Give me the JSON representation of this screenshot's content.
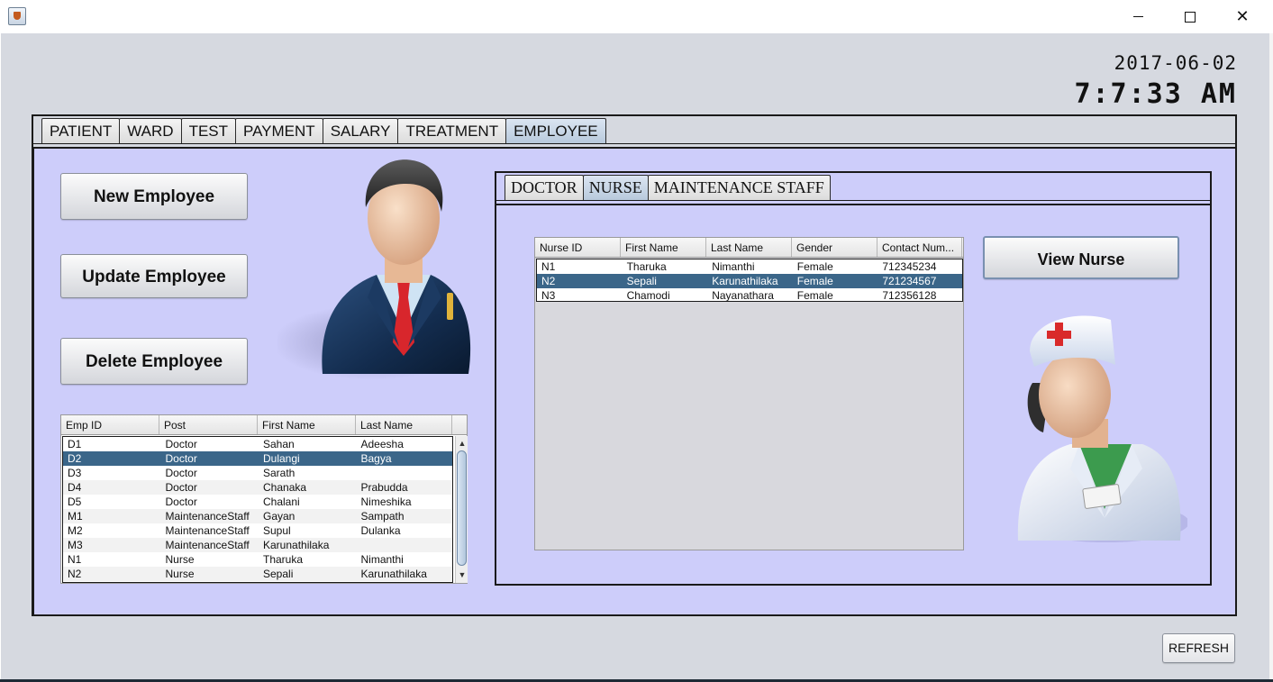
{
  "window": {
    "close_glyph": "✕"
  },
  "clock": {
    "date": "2017-06-02",
    "time": "7:7:33 AM"
  },
  "main_tabs": [
    "PATIENT",
    "WARD",
    "TEST",
    "PAYMENT",
    "SALARY",
    "TREATMENT",
    "EMPLOYEE"
  ],
  "main_tabs_active": "EMPLOYEE",
  "employee": {
    "new_button": "New Employee",
    "update_button": "Update Employee",
    "delete_button": "Delete Employee",
    "table": {
      "columns": [
        "Emp ID",
        "Post",
        "First Name",
        "Last Name"
      ],
      "rows": [
        [
          "D1",
          "Doctor",
          "Sahan",
          "Adeesha"
        ],
        [
          "D2",
          "Doctor",
          "Dulangi",
          "Bagya"
        ],
        [
          "D3",
          "Doctor",
          "Sarath",
          ""
        ],
        [
          "D4",
          "Doctor",
          "Chanaka",
          "Prabudda"
        ],
        [
          "D5",
          "Doctor",
          "Chalani",
          "Nimeshika"
        ],
        [
          "M1",
          "MaintenanceStaff",
          "Gayan",
          "Sampath"
        ],
        [
          "M2",
          "MaintenanceStaff",
          "Supul",
          "Dulanka"
        ],
        [
          "M3",
          "MaintenanceStaff",
          "Karunathilaka",
          ""
        ],
        [
          "N1",
          "Nurse",
          "Tharuka",
          "Nimanthi"
        ],
        [
          "N2",
          "Nurse",
          "Sepali",
          "Karunathilaka"
        ]
      ],
      "selected_row": 1
    }
  },
  "sub_tabs": [
    "DOCTOR",
    "NURSE",
    "MAINTENANCE STAFF"
  ],
  "sub_tabs_active": "NURSE",
  "nurse": {
    "view_button": "View Nurse",
    "table": {
      "columns": [
        "Nurse ID",
        "First Name",
        "Last Name",
        "Gender",
        "Contact Num..."
      ],
      "rows": [
        [
          "N1",
          "Tharuka",
          "Nimanthi",
          "Female",
          "712345234"
        ],
        [
          "N2",
          "Sepali",
          "Karunathilaka",
          "Female",
          "721234567"
        ],
        [
          "N3",
          "Chamodi",
          "Nayanathara",
          "Female",
          "712356128"
        ]
      ],
      "selected_row": 1
    }
  },
  "refresh_button": "REFRESH",
  "colors": {
    "panel_bg": "#cdcdfa",
    "selection": "#3b6689",
    "window_bg": "#d6d9e0"
  }
}
